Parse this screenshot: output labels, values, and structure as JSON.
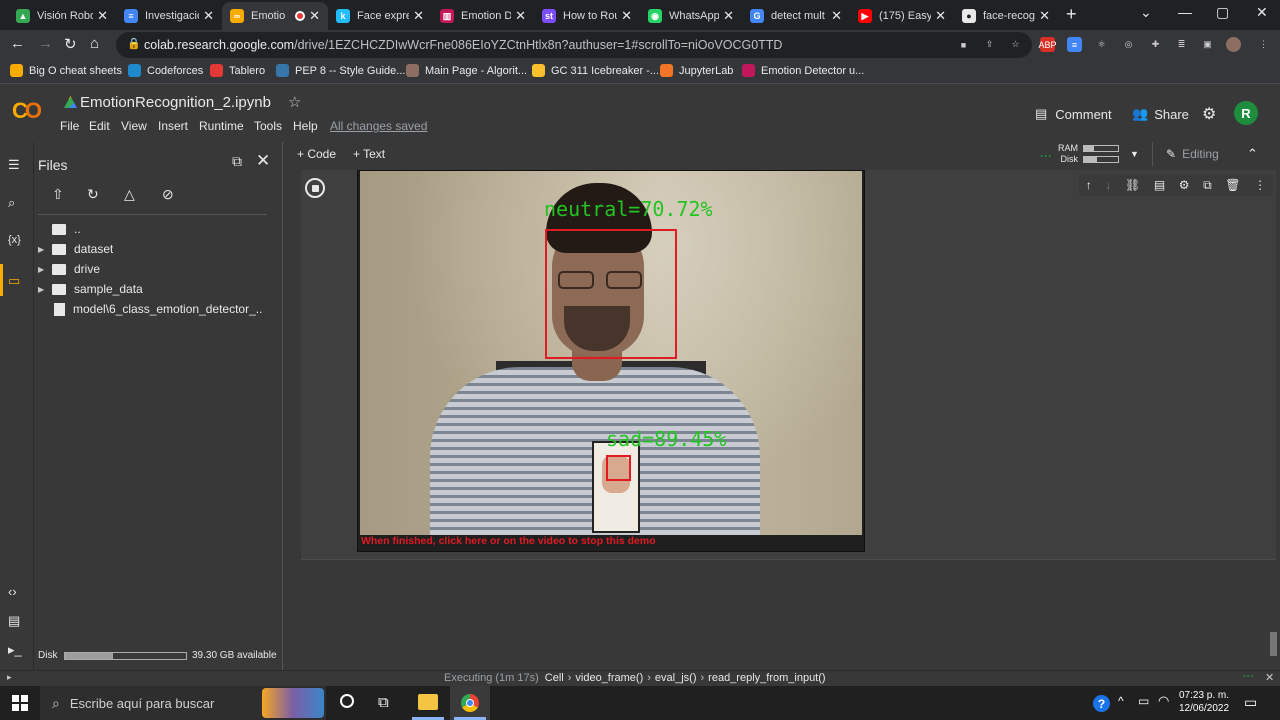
{
  "tabs": [
    {
      "label": "Visión Robo",
      "color": "#34a853",
      "glyph": "▲",
      "active": false
    },
    {
      "label": "Investigació",
      "color": "#4285f4",
      "glyph": "≡",
      "active": false
    },
    {
      "label": "Emotio",
      "color": "#f9ab00",
      "glyph": "∞",
      "active": true
    },
    {
      "label": "Face expres",
      "color": "#20beff",
      "glyph": "k",
      "active": false
    },
    {
      "label": "Emotion De",
      "color": "#c2185b",
      "glyph": "▥",
      "active": false
    },
    {
      "label": "How to Rou",
      "color": "#7c4dff",
      "glyph": "st",
      "active": false
    },
    {
      "label": "WhatsApp",
      "color": "#25d366",
      "glyph": "◉",
      "active": false
    },
    {
      "label": "detect mult",
      "color": "#4285f4",
      "glyph": "G",
      "active": false
    },
    {
      "label": "(175) Easy I",
      "color": "#ff0000",
      "glyph": "▶",
      "active": false
    },
    {
      "label": "face-recogn",
      "color": "#e8e8e8",
      "glyph": "●",
      "active": false
    }
  ],
  "toolbar": {
    "url_host": "colab.research.google.com",
    "url_path": "/drive/1EZCHCZDIwWcrFne086EIoYZCtnHtlx8n?authuser=1#scrollTo=niOoVOCG0TTD"
  },
  "bookmarks": [
    {
      "label": "Big O cheat sheets",
      "color": "#f9ab00"
    },
    {
      "label": "Codeforces",
      "color": "#1f8acb"
    },
    {
      "label": "Tablero",
      "color": "#e53935"
    },
    {
      "label": "PEP 8 -- Style Guide...",
      "color": "#3776ab"
    },
    {
      "label": "Main Page - Algorit...",
      "color": "#8d6e63"
    },
    {
      "label": "GC 311 Icebreaker -...",
      "color": "#fbc02d"
    },
    {
      "label": "JupyterLab",
      "color": "#f37626"
    },
    {
      "label": "Emotion Detector u...",
      "color": "#c2185b"
    }
  ],
  "colab": {
    "title": "EmotionRecognition_2.ipynb",
    "menus": [
      "File",
      "Edit",
      "View",
      "Insert",
      "Runtime",
      "Tools",
      "Help"
    ],
    "saved": "All changes saved",
    "comment": "Comment",
    "share": "Share",
    "avatar": "R",
    "add_code": "+ Code",
    "add_text": "+ Text",
    "ram": "RAM",
    "disk": "Disk",
    "editing": "Editing"
  },
  "files": {
    "title": "Files",
    "items": [
      {
        "label": "..",
        "kind": "up"
      },
      {
        "label": "dataset",
        "kind": "folder"
      },
      {
        "label": "drive",
        "kind": "folder"
      },
      {
        "label": "sample_data",
        "kind": "folder"
      },
      {
        "label": "model\\6_class_emotion_detector_...",
        "kind": "file"
      }
    ],
    "disk_label": "Disk",
    "disk_available": "39.30 GB available",
    "disk_fraction": 0.4
  },
  "video": {
    "face1_label": "neutral=70.72%",
    "face2_label": "sad=89.45%",
    "stop_text": "When finished, click here or on the video to stop this demo"
  },
  "status": {
    "executing": "Executing (1m 17s)",
    "trail": [
      "Cell",
      "video_frame()",
      "eval_js()",
      "read_reply_from_input()"
    ]
  },
  "taskbar": {
    "search": "Escribe aquí para buscar",
    "time": "07:23 p. m.",
    "date": "12/06/2022"
  }
}
